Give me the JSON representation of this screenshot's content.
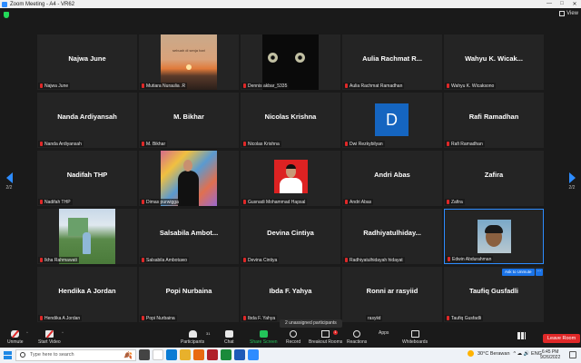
{
  "window": {
    "title": "Zoom Meeting - A4 - VR62",
    "controls": [
      "—",
      "□",
      "✕"
    ]
  },
  "view": {
    "label": "View"
  },
  "pager": {
    "left": "2/2",
    "right": "2/2"
  },
  "tiles": [
    {
      "big": "Najwa June",
      "label": "Najwa June"
    },
    {
      "big": "",
      "label": "Mutiara Nuraulia .R",
      "photo_text": "sebuah di senja hari"
    },
    {
      "big": "",
      "label": "Dennis akbar_5335"
    },
    {
      "big": "Aulia Rachmat R...",
      "label": "Aulia Rachmat Ramadhan"
    },
    {
      "big": "Wahyu K. Wicak...",
      "label": "Wahyu K. Wicaksono"
    },
    {
      "big": "Nanda Ardiyansah",
      "label": "Nanda Ardiyansah"
    },
    {
      "big": "M. Bikhar",
      "label": "M. Bikhar"
    },
    {
      "big": "Nicolas Krishna",
      "label": "Nicolas Krishna"
    },
    {
      "big": "",
      "label": "Dwi Rezkybilyan",
      "avatar_letter": "D"
    },
    {
      "big": "Rafi Ramadhan",
      "label": "Rafi Ramadhan"
    },
    {
      "big": "Nadifah THP",
      "label": "Nadifah THP"
    },
    {
      "big": "",
      "label": "Dimas purwigga"
    },
    {
      "big": "",
      "label": "Gusnadi Mohammad Hapsal"
    },
    {
      "big": "Andri Abas",
      "label": "Andri Abas"
    },
    {
      "big": "Zafira",
      "label": "Zafira"
    },
    {
      "big": "",
      "label": "Ikha Rahmawati"
    },
    {
      "big": "Salsabila Ambot...",
      "label": "Salsabila Ambotuwo"
    },
    {
      "big": "Devina Cintiya",
      "label": "Devina Cintiya"
    },
    {
      "big": "Radhiyatulhiday...",
      "label": "Radhiyatulhidayah hidayat"
    },
    {
      "big": "",
      "label": "Edwin Abdurahman"
    },
    {
      "big": "Hendika A Jordan",
      "label": "Hendika A Jordan"
    },
    {
      "big": "Popi Nurbaina",
      "label": "Popi Nurbaina"
    },
    {
      "big": "Ibda F. Yahya",
      "label": "Ibda F. Yahya"
    },
    {
      "big": "Ronni ar rasyiid",
      "label": "rasyiid"
    },
    {
      "big": "Taufiq Gusfadli",
      "label": "Taufiq Gusfadli"
    }
  ],
  "ask_unmute": "Ask to Unmute",
  "more_dots": "···",
  "unassigned": "2 unassigned participants",
  "toolbar": {
    "unmute": "Unmute",
    "start_video": "Start Video",
    "participants": "Participants",
    "participants_count": "31",
    "chat": "Chat",
    "share_screen": "Share Screen",
    "record": "Record",
    "breakout_rooms": "Breakout Rooms",
    "breakout_badge": "1",
    "reactions": "Reactions",
    "apps": "Apps",
    "whiteboards": "Whiteboards",
    "leave": "Leave Room"
  },
  "taskbar": {
    "search_placeholder": "Type here to search",
    "weather": "30°C  Berawan",
    "sys_icons": "^  ☁  🔊  ENG",
    "time": "6:45 PM",
    "date": "9/26/2022"
  },
  "colors": {
    "accent": "#2d8cff",
    "leave": "#e02828",
    "share": "#23c45a",
    "tile": "#242424"
  }
}
